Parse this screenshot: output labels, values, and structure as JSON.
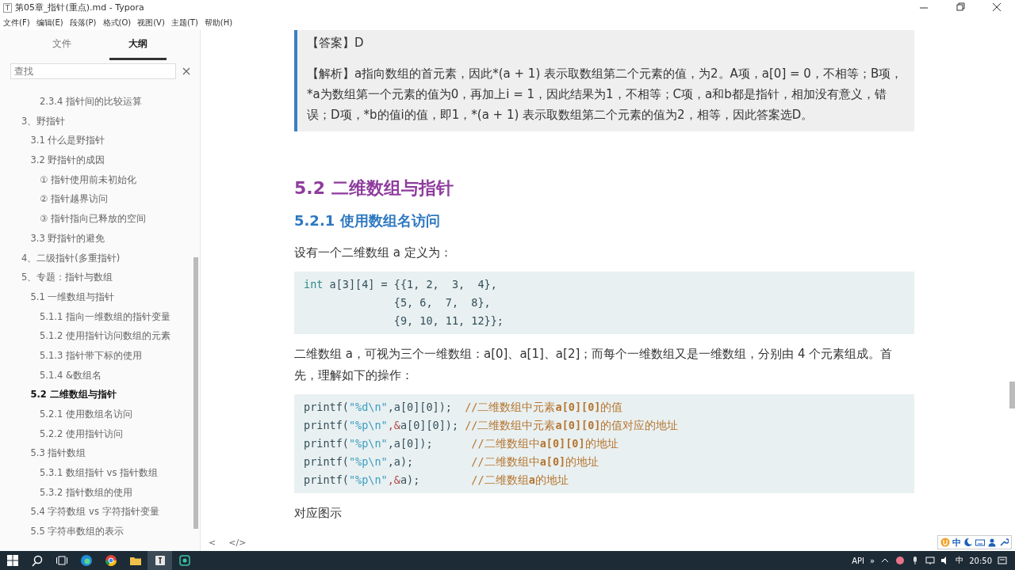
{
  "window": {
    "app_icon": "T",
    "title": "第05章_指针(重点).md - Typora"
  },
  "menu": [
    "文件(F)",
    "编辑(E)",
    "段落(P)",
    "格式(O)",
    "视图(V)",
    "主题(T)",
    "帮助(H)"
  ],
  "sidebar": {
    "tabs": [
      {
        "label": "文件",
        "selected": false
      },
      {
        "label": "大纲",
        "selected": true
      }
    ],
    "search": {
      "placeholder": "查找"
    },
    "outline": [
      {
        "children": [
          {
            "children": [
              {
                "label": "2.3.4 指针间的比较运算",
                "selected": false
              }
            ]
          }
        ]
      },
      {
        "label": "3、野指针",
        "selected": false,
        "children": [
          {
            "label": "3.1 什么是野指针",
            "selected": false
          },
          {
            "label": "3.2 野指针的成因",
            "selected": false,
            "children": [
              {
                "label": "① 指针使用前未初始化",
                "selected": false
              },
              {
                "label": "② 指针越界访问",
                "selected": false
              },
              {
                "label": "③ 指针指向已释放的空间",
                "selected": false
              }
            ]
          },
          {
            "label": "3.3 野指针的避免",
            "selected": false
          }
        ]
      },
      {
        "label": "4、二级指针(多重指针)",
        "selected": false
      },
      {
        "label": "5、专题：指针与数组",
        "selected": false,
        "children": [
          {
            "label": "5.1 一维数组与指针",
            "selected": false,
            "children": [
              {
                "label": "5.1.1 指向一维数组的指针变量",
                "selected": false
              },
              {
                "label": "5.1.2 使用指针访问数组的元素",
                "selected": false
              },
              {
                "label": "5.1.3 指针带下标的使用",
                "selected": false
              },
              {
                "label": "5.1.4 &数组名",
                "selected": false
              }
            ]
          },
          {
            "label": "5.2 二维数组与指针",
            "selected": true,
            "children": [
              {
                "label": "5.2.1 使用数组名访问",
                "selected": false
              },
              {
                "label": "5.2.2 使用指针访问",
                "selected": false
              }
            ]
          },
          {
            "label": "5.3 指针数组",
            "selected": false,
            "children": [
              {
                "label": "5.3.1 数组指针 vs 指针数组",
                "selected": false
              },
              {
                "label": "5.3.2 指针数组的使用",
                "selected": false
              }
            ]
          },
          {
            "label": "5.4 字符数组 vs 字符指针变量",
            "selected": false
          },
          {
            "label": "5.5 字符串数组的表示",
            "selected": false
          }
        ]
      }
    ],
    "footer": [
      "<",
      "</>"
    ]
  },
  "document": [
    {
      "kind": "quote",
      "paragraphs": [
        "【答案】D",
        "【解析】a指向数组的首元素，因此*(a + 1) 表示取数组第二个元素的值，为2。A项，a[0] = 0，不相等；B项，*a为数组第一个元素的值为0，再加上i = 1，因此结果为1，不相等；C项，a和b都是指针，相加没有意义，错误；D项，*b的值i的值，即1，*(a + 1) 表示取数组第二个元素的值为2，相等，因此答案选D。"
      ]
    },
    {
      "kind": "h2",
      "text": "5.2 二维数组与指针"
    },
    {
      "kind": "h3",
      "text": "5.2.1 使用数组名访问"
    },
    {
      "kind": "p",
      "text": "设有一个二维数组 a 定义为："
    },
    {
      "kind": "code",
      "lines": [
        [
          {
            "kind": "keyword",
            "text": "int"
          },
          {
            "kind": "plain",
            "text": " a[3][4] = {{1, 2,  3,  4},"
          }
        ],
        [
          {
            "kind": "plain",
            "text": "              {5, 6,  7,  8},"
          }
        ],
        [
          {
            "kind": "plain",
            "text": "              {9, 10, 11, 12}};"
          }
        ]
      ]
    },
    {
      "kind": "p",
      "text": "二维数组 a，可视为三个一维数组：a[0]、a[1]、a[2]；而每个一维数组又是一维数组，分别由 4 个元素组成。首先，理解如下的操作："
    },
    {
      "kind": "code",
      "lines": [
        [
          {
            "kind": "plain",
            "text": "printf("
          },
          {
            "kind": "string",
            "text": "\"%d\\n\""
          },
          {
            "kind": "plain",
            "text": ",a[0][0]);  "
          },
          {
            "kind": "comment",
            "text": "//二维数组中元素**a[0][0]**的值"
          }
        ],
        [
          {
            "kind": "plain",
            "text": "printf("
          },
          {
            "kind": "string",
            "text": "\"%p\\n\""
          },
          {
            "kind": "operator",
            "text": ",&"
          },
          {
            "kind": "plain",
            "text": "a[0][0]); "
          },
          {
            "kind": "comment",
            "text": "//二维数组中元素**a[0][0]**的值对应的地址"
          }
        ],
        [
          {
            "kind": "plain",
            "text": "printf("
          },
          {
            "kind": "string",
            "text": "\"%p\\n\""
          },
          {
            "kind": "plain",
            "text": ",a[0]);      "
          },
          {
            "kind": "comment",
            "text": "//二维数组中**a[0][0]**的地址"
          }
        ],
        [
          {
            "kind": "plain",
            "text": "printf("
          },
          {
            "kind": "string",
            "text": "\"%p\\n\""
          },
          {
            "kind": "plain",
            "text": ",a);         "
          },
          {
            "kind": "comment",
            "text": "//二维数组中**a[0]**的地址"
          }
        ],
        [
          {
            "kind": "plain",
            "text": "printf("
          },
          {
            "kind": "string",
            "text": "\"%p\\n\""
          },
          {
            "kind": "operator",
            "text": ",&"
          },
          {
            "kind": "plain",
            "text": "a);        "
          },
          {
            "kind": "comment",
            "text": "//二维数组**a**的地址"
          }
        ]
      ]
    },
    {
      "kind": "p",
      "text": "对应图示"
    }
  ],
  "ime": {
    "label": "中"
  },
  "taskbar": {
    "tray": [
      "API",
      "»"
    ],
    "ime": "中",
    "clock": "20:50"
  }
}
